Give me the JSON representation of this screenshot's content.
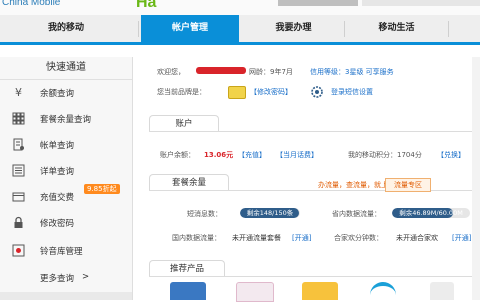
{
  "header": {
    "logo_text": "China Mobile",
    "logo_mark": "Ha"
  },
  "nav": {
    "tabs": [
      {
        "label": "我的移动",
        "active": false
      },
      {
        "label": "帐户管理",
        "active": true
      },
      {
        "label": "我要办理",
        "active": false
      },
      {
        "label": "移动生活",
        "active": false
      }
    ]
  },
  "sidebar": {
    "title": "快速通道",
    "items": [
      {
        "label": "余额查询",
        "icon": "yen-icon"
      },
      {
        "label": "套餐余量查询",
        "icon": "grid-icon"
      },
      {
        "label": "帐单查询",
        "icon": "bill-icon"
      },
      {
        "label": "详单查询",
        "icon": "list-icon"
      },
      {
        "label": "充值交费",
        "icon": "card-icon"
      },
      {
        "label": "修改密码",
        "icon": "lock-icon"
      },
      {
        "label": "铃音库管理",
        "icon": "bell-icon"
      }
    ],
    "promo_badge": "9.85折起",
    "more": "更多查询",
    "more_arrow": ">"
  },
  "welcome": {
    "greeting": "欢迎您，",
    "net_age": "网龄：9年7月",
    "credit": "信用等级：3星级 可享服务",
    "brand_label": "您当前品牌是：",
    "change_pwd": "【修改密码】",
    "sms_setting": "登录短信设置"
  },
  "account": {
    "tab": "账户",
    "balance_label": "账户余额：",
    "balance_value": "13.06元",
    "recharge": "【充值】",
    "month_bill": "【当月话费】",
    "points_label": "我的移动积分：1704分",
    "redeem": "【兑换】"
  },
  "package": {
    "tab": "套餐余量",
    "promo_text": "办流量，查流量，就上",
    "promo_button": "流量专区",
    "sms_label": "短消息数：",
    "sms_bar": "剩余148/150条",
    "sms_fraction": 0.986,
    "data_label": "省内数据流量：",
    "data_bar": "剩余46.89M/60.00M",
    "data_fraction": 0.78,
    "national_label": "国内数据流量：",
    "national_value": "未开通流量套餐",
    "national_link": "[开通]",
    "family_label": "合家欢分钟数：",
    "family_value": "未开通合家欢",
    "family_link": "[开通]"
  },
  "recommend": {
    "tab": "推荐产品"
  },
  "colors": {
    "primary": "#0a8fd8",
    "red": "#d9242a",
    "orange": "#ff8a1e",
    "link": "#1a6fc9",
    "bar": "#2f5d8a"
  }
}
